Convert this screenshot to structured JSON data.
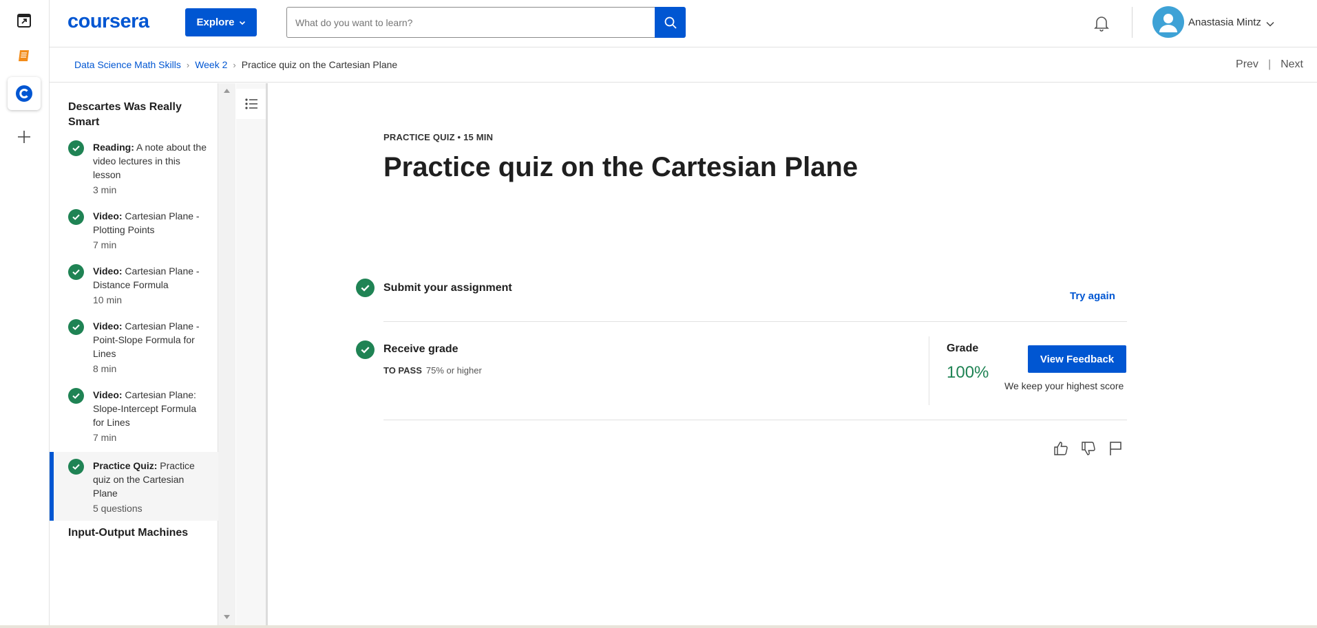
{
  "header": {
    "logo": "coursera",
    "explore_label": "Explore",
    "search_placeholder": "What do you want to learn?",
    "user_name": "Anastasia Mintz"
  },
  "breadcrumb": {
    "items": [
      "Data Science Math Skills",
      "Week 2",
      "Practice quiz on the Cartesian Plane"
    ],
    "prev": "Prev",
    "separator": "|",
    "next": "Next"
  },
  "sidebar": {
    "section_title": "Descartes Was Really Smart",
    "items": [
      {
        "type": "Reading:",
        "name": "A note about the video lectures in this lesson",
        "duration": "3 min"
      },
      {
        "type": "Video:",
        "name": "Cartesian Plane - Plotting Points",
        "duration": "7 min"
      },
      {
        "type": "Video:",
        "name": "Cartesian Plane - Distance Formula",
        "duration": "10 min"
      },
      {
        "type": "Video:",
        "name": "Cartesian Plane - Point-Slope Formula for Lines",
        "duration": "8 min"
      },
      {
        "type": "Video:",
        "name": "Cartesian Plane: Slope-Intercept Formula for Lines",
        "duration": "7 min"
      },
      {
        "type": "Practice Quiz:",
        "name": "Practice quiz on the Cartesian Plane",
        "duration": "5 questions"
      }
    ],
    "next_section_title": "Input-Output Machines"
  },
  "main": {
    "meta": "PRACTICE QUIZ • 15 MIN",
    "title": "Practice quiz on the Cartesian Plane",
    "submit_title": "Submit your assignment",
    "try_again": "Try again",
    "receive_title": "Receive grade",
    "to_pass_label": "TO PASS",
    "to_pass_value": "75% or higher",
    "grade_label": "Grade",
    "grade_value": "100%",
    "view_feedback": "View Feedback",
    "keep_note": "We keep your highest score"
  },
  "colors": {
    "brand": "#0056d2",
    "success": "#1f8354"
  }
}
